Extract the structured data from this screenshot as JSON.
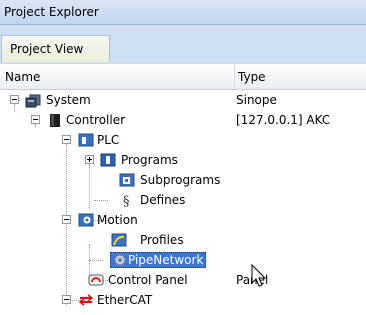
{
  "panel": {
    "title": "Project Explorer"
  },
  "tabs": [
    {
      "label": "Project View"
    }
  ],
  "columns": {
    "name": "Name",
    "type": "Type"
  },
  "tree": [
    {
      "label": "System",
      "type": "Sinope",
      "icon": "system-icon"
    },
    {
      "label": "Controller",
      "type": "[127.0.0.1] AKC",
      "icon": "controller-icon"
    },
    {
      "label": "PLC",
      "type": "",
      "icon": "plc-icon"
    },
    {
      "label": "Programs",
      "type": "",
      "icon": "programs-icon"
    },
    {
      "label": "Subprograms",
      "type": "",
      "icon": "subprograms-icon"
    },
    {
      "label": "Defines",
      "type": "",
      "icon": "defines-icon"
    },
    {
      "label": "Motion",
      "type": "",
      "icon": "motion-icon"
    },
    {
      "label": "Profiles",
      "type": "",
      "icon": "profiles-icon"
    },
    {
      "label": "PipeNetwork",
      "type": "",
      "icon": "pipenetwork-gear-icon",
      "selected": true
    },
    {
      "label": "Control Panel",
      "type": "Panel",
      "icon": "control-panel-icon"
    },
    {
      "label": "EtherCAT",
      "type": "",
      "icon": "ethercat-icon"
    }
  ]
}
